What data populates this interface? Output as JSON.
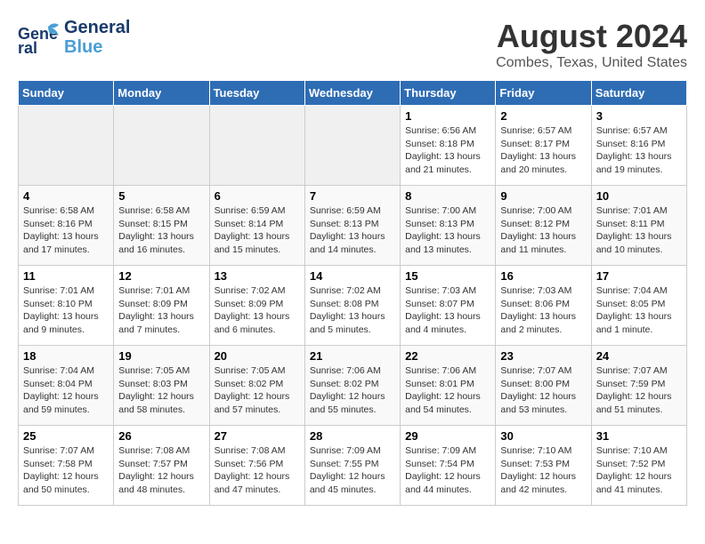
{
  "logo": {
    "line1": "General",
    "line2": "Blue"
  },
  "title": "August 2024",
  "location": "Combes, Texas, United States",
  "weekdays": [
    "Sunday",
    "Monday",
    "Tuesday",
    "Wednesday",
    "Thursday",
    "Friday",
    "Saturday"
  ],
  "weeks": [
    [
      {
        "day": "",
        "info": ""
      },
      {
        "day": "",
        "info": ""
      },
      {
        "day": "",
        "info": ""
      },
      {
        "day": "",
        "info": ""
      },
      {
        "day": "1",
        "info": "Sunrise: 6:56 AM\nSunset: 8:18 PM\nDaylight: 13 hours\nand 21 minutes."
      },
      {
        "day": "2",
        "info": "Sunrise: 6:57 AM\nSunset: 8:17 PM\nDaylight: 13 hours\nand 20 minutes."
      },
      {
        "day": "3",
        "info": "Sunrise: 6:57 AM\nSunset: 8:16 PM\nDaylight: 13 hours\nand 19 minutes."
      }
    ],
    [
      {
        "day": "4",
        "info": "Sunrise: 6:58 AM\nSunset: 8:16 PM\nDaylight: 13 hours\nand 17 minutes."
      },
      {
        "day": "5",
        "info": "Sunrise: 6:58 AM\nSunset: 8:15 PM\nDaylight: 13 hours\nand 16 minutes."
      },
      {
        "day": "6",
        "info": "Sunrise: 6:59 AM\nSunset: 8:14 PM\nDaylight: 13 hours\nand 15 minutes."
      },
      {
        "day": "7",
        "info": "Sunrise: 6:59 AM\nSunset: 8:13 PM\nDaylight: 13 hours\nand 14 minutes."
      },
      {
        "day": "8",
        "info": "Sunrise: 7:00 AM\nSunset: 8:13 PM\nDaylight: 13 hours\nand 13 minutes."
      },
      {
        "day": "9",
        "info": "Sunrise: 7:00 AM\nSunset: 8:12 PM\nDaylight: 13 hours\nand 11 minutes."
      },
      {
        "day": "10",
        "info": "Sunrise: 7:01 AM\nSunset: 8:11 PM\nDaylight: 13 hours\nand 10 minutes."
      }
    ],
    [
      {
        "day": "11",
        "info": "Sunrise: 7:01 AM\nSunset: 8:10 PM\nDaylight: 13 hours\nand 9 minutes."
      },
      {
        "day": "12",
        "info": "Sunrise: 7:01 AM\nSunset: 8:09 PM\nDaylight: 13 hours\nand 7 minutes."
      },
      {
        "day": "13",
        "info": "Sunrise: 7:02 AM\nSunset: 8:09 PM\nDaylight: 13 hours\nand 6 minutes."
      },
      {
        "day": "14",
        "info": "Sunrise: 7:02 AM\nSunset: 8:08 PM\nDaylight: 13 hours\nand 5 minutes."
      },
      {
        "day": "15",
        "info": "Sunrise: 7:03 AM\nSunset: 8:07 PM\nDaylight: 13 hours\nand 4 minutes."
      },
      {
        "day": "16",
        "info": "Sunrise: 7:03 AM\nSunset: 8:06 PM\nDaylight: 13 hours\nand 2 minutes."
      },
      {
        "day": "17",
        "info": "Sunrise: 7:04 AM\nSunset: 8:05 PM\nDaylight: 13 hours\nand 1 minute."
      }
    ],
    [
      {
        "day": "18",
        "info": "Sunrise: 7:04 AM\nSunset: 8:04 PM\nDaylight: 12 hours\nand 59 minutes."
      },
      {
        "day": "19",
        "info": "Sunrise: 7:05 AM\nSunset: 8:03 PM\nDaylight: 12 hours\nand 58 minutes."
      },
      {
        "day": "20",
        "info": "Sunrise: 7:05 AM\nSunset: 8:02 PM\nDaylight: 12 hours\nand 57 minutes."
      },
      {
        "day": "21",
        "info": "Sunrise: 7:06 AM\nSunset: 8:02 PM\nDaylight: 12 hours\nand 55 minutes."
      },
      {
        "day": "22",
        "info": "Sunrise: 7:06 AM\nSunset: 8:01 PM\nDaylight: 12 hours\nand 54 minutes."
      },
      {
        "day": "23",
        "info": "Sunrise: 7:07 AM\nSunset: 8:00 PM\nDaylight: 12 hours\nand 53 minutes."
      },
      {
        "day": "24",
        "info": "Sunrise: 7:07 AM\nSunset: 7:59 PM\nDaylight: 12 hours\nand 51 minutes."
      }
    ],
    [
      {
        "day": "25",
        "info": "Sunrise: 7:07 AM\nSunset: 7:58 PM\nDaylight: 12 hours\nand 50 minutes."
      },
      {
        "day": "26",
        "info": "Sunrise: 7:08 AM\nSunset: 7:57 PM\nDaylight: 12 hours\nand 48 minutes."
      },
      {
        "day": "27",
        "info": "Sunrise: 7:08 AM\nSunset: 7:56 PM\nDaylight: 12 hours\nand 47 minutes."
      },
      {
        "day": "28",
        "info": "Sunrise: 7:09 AM\nSunset: 7:55 PM\nDaylight: 12 hours\nand 45 minutes."
      },
      {
        "day": "29",
        "info": "Sunrise: 7:09 AM\nSunset: 7:54 PM\nDaylight: 12 hours\nand 44 minutes."
      },
      {
        "day": "30",
        "info": "Sunrise: 7:10 AM\nSunset: 7:53 PM\nDaylight: 12 hours\nand 42 minutes."
      },
      {
        "day": "31",
        "info": "Sunrise: 7:10 AM\nSunset: 7:52 PM\nDaylight: 12 hours\nand 41 minutes."
      }
    ]
  ]
}
